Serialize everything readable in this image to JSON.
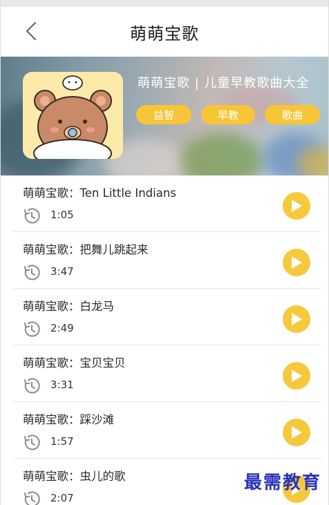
{
  "header": {
    "title": "萌萌宝歌"
  },
  "banner": {
    "text": "萌萌宝歌 | 儿童早教歌曲大全",
    "tags": [
      "益智",
      "早教",
      "歌曲"
    ]
  },
  "songs": [
    {
      "title": "萌萌宝歌：Ten Little Indians",
      "duration": "1:05"
    },
    {
      "title": "萌萌宝歌：把舞儿跳起来",
      "duration": "3:47"
    },
    {
      "title": "萌萌宝歌：白龙马",
      "duration": "2:49"
    },
    {
      "title": "萌萌宝歌：宝贝宝贝",
      "duration": "3:31"
    },
    {
      "title": "萌萌宝歌：踩沙滩",
      "duration": "1:57"
    },
    {
      "title": "萌萌宝歌：虫儿的歌",
      "duration": "2:07"
    }
  ],
  "watermark": "最需教育",
  "colors": {
    "accent": "#f6c93d",
    "watermark": "#2a33b8"
  }
}
